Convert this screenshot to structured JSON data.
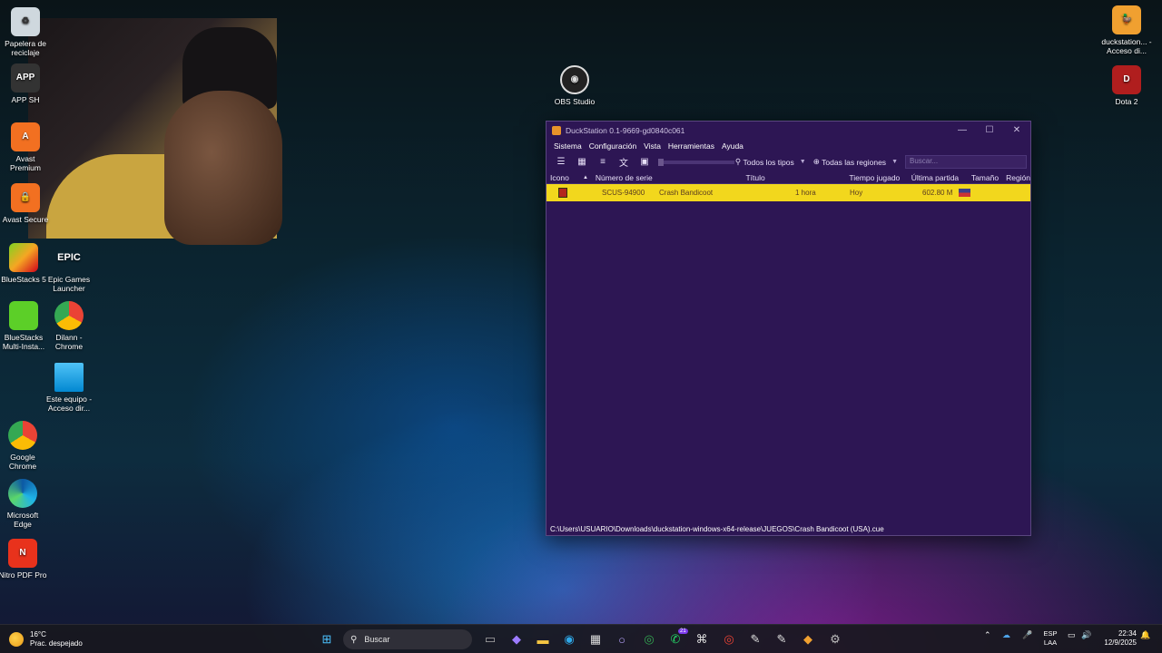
{
  "desktop": {
    "left_icons": [
      {
        "label": "Papelera de reciclaje",
        "icon": "recycle-bin-icon"
      },
      {
        "label": "APP SH",
        "icon": "app-icon"
      },
      {
        "label": "Avast Premium",
        "icon": "avast-icon"
      },
      {
        "label": "Avast Secure",
        "icon": "avast-secure-icon"
      },
      {
        "label": "BlueStacks 5",
        "icon": "bluestacks-icon"
      },
      {
        "label": "Epic Games Launcher",
        "icon": "epic-games-icon"
      },
      {
        "label": "BlueStacks Multi-Insta...",
        "icon": "bluestacks-multi-icon"
      },
      {
        "label": "Dilann - Chrome",
        "icon": "chrome-profile-icon"
      },
      {
        "label": "Este equipo - Acceso dir...",
        "icon": "computer-icon"
      },
      {
        "label": "Google Chrome",
        "icon": "chrome-icon"
      },
      {
        "label": "Microsoft Edge",
        "icon": "edge-icon"
      },
      {
        "label": "Nitro PDF Pro",
        "icon": "nitro-pdf-icon"
      }
    ],
    "obs_label": "OBS Studio",
    "duck_label": "duckstation... - Acceso di...",
    "dota_label": "Dota 2"
  },
  "window": {
    "title": "DuckStation 0.1-9669-gd0840c061",
    "menu": [
      "Sistema",
      "Configuración",
      "Vista",
      "Herramientas",
      "Ayuda"
    ],
    "filter_types": "Todos los tipos",
    "filter_regions": "Todas las regiones",
    "search_placeholder": "Buscar...",
    "columns": {
      "icon": "Icono",
      "serial": "Número de serie",
      "title": "Título",
      "time": "Tiempo jugado",
      "last": "Última partida",
      "size": "Tamaño",
      "region": "Región"
    },
    "rows": [
      {
        "serial": "SCUS-94900",
        "title": "Crash Bandicoot",
        "time": "1 hora",
        "last": "Hoy",
        "size": "602.80 MB"
      }
    ],
    "status": "C:\\Users\\USUARIO\\Downloads\\duckstation-windows-x64-release\\JUEGOS\\Crash Bandicoot (USA).cue"
  },
  "taskbar": {
    "temp": "16°C",
    "weather": "Prac. despejado",
    "search": "Buscar",
    "lang1": "ESP",
    "lang2": "LAA",
    "time": "22:34",
    "date": "12/9/2025",
    "whatsapp_badge": "21"
  }
}
